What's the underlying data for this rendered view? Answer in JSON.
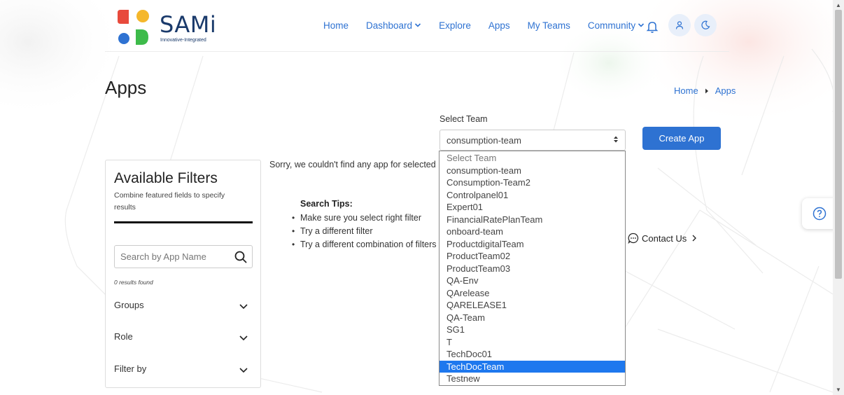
{
  "logo": {
    "title": "SAMi",
    "tagline": "Innovative-Integrated"
  },
  "nav": {
    "items": [
      {
        "label": "Home"
      },
      {
        "label": "Dashboard",
        "has_dropdown": true
      },
      {
        "label": "Explore"
      },
      {
        "label": "Apps"
      },
      {
        "label": "My Teams"
      },
      {
        "label": "Community",
        "has_dropdown": true
      }
    ],
    "icons": [
      "bell-icon",
      "user-icon",
      "moon-icon"
    ]
  },
  "page": {
    "title": "Apps"
  },
  "breadcrumb": {
    "home": "Home",
    "current": "Apps"
  },
  "team_select": {
    "label": "Select Team",
    "value": "consumption-team",
    "options": [
      "Select Team",
      "consumption-team",
      "Consumption-Team2",
      "Controlpanel01",
      "Expert01",
      "FinancialRatePlanTeam",
      "onboard-team",
      "ProductdigitalTeam",
      "ProductTeam02",
      "ProductTeam03",
      "QA-Env",
      "QArelease",
      "QARELEASE1",
      "QA-Team",
      "SG1",
      "T",
      "TechDoc01",
      "TechDocTeam",
      "Testnew"
    ],
    "highlighted": "TechDocTeam"
  },
  "create_button": {
    "label": "Create App"
  },
  "filters": {
    "title": "Available Filters",
    "subtitle": "Combine featured fields to specify results",
    "search_placeholder": "Search by App Name",
    "results_text": "0 results found",
    "sections": [
      "Groups",
      "Role",
      "Filter by"
    ]
  },
  "empty_state": {
    "message": "Sorry, we couldn't find any app for selected",
    "tips_title": "Search Tips:",
    "tips": [
      "Make sure you select right filter",
      "Try a different filter",
      "Try a different combination of filters"
    ],
    "contact_label": "Contact Us"
  },
  "colors": {
    "accent": "#2e72d2",
    "brand_dark": "#1a3a6b",
    "selected_option": "#1e78ee"
  }
}
